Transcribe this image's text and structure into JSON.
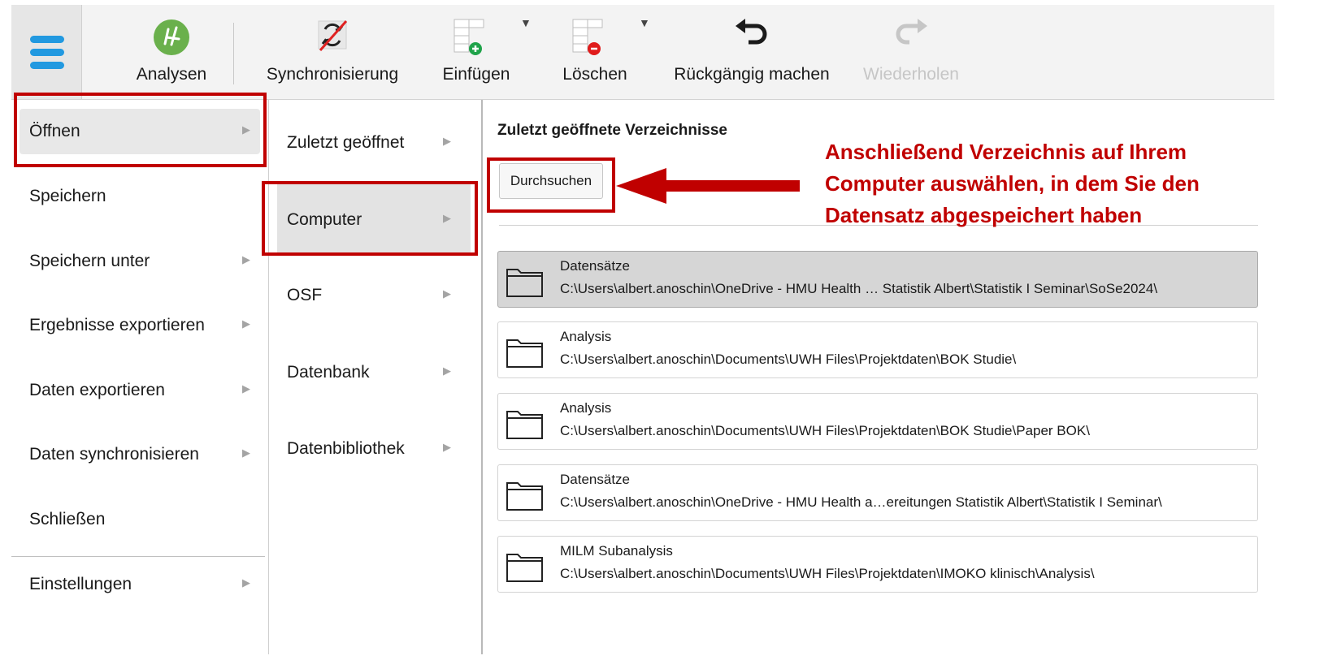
{
  "toolbar": {
    "analysen": "Analysen",
    "synchronisierung": "Synchronisierung",
    "einfuegen": "Einfügen",
    "loeschen": "Löschen",
    "rueckgaengig": "Rückgängig machen",
    "wiederholen": "Wiederholen"
  },
  "menu1": {
    "items": [
      {
        "label": "Öffnen"
      },
      {
        "label": "Speichern"
      },
      {
        "label": "Speichern unter"
      },
      {
        "label": "Ergebnisse exportieren"
      },
      {
        "label": "Daten exportieren"
      },
      {
        "label": "Daten synchronisieren"
      },
      {
        "label": "Schließen"
      },
      {
        "label": "Einstellungen"
      }
    ]
  },
  "menu2": {
    "items": [
      {
        "label": "Zuletzt geöffnet"
      },
      {
        "label": "Computer"
      },
      {
        "label": "OSF"
      },
      {
        "label": "Datenbank"
      },
      {
        "label": "Datenbibliothek"
      }
    ]
  },
  "panel": {
    "title": "Zuletzt geöffnete Verzeichnisse",
    "browse": "Durchsuchen",
    "entries": [
      {
        "name": "Datensätze",
        "path": "C:\\Users\\albert.anoschin\\OneDrive - HMU Health … Statistik Albert\\Statistik I Seminar\\SoSe2024\\"
      },
      {
        "name": "Analysis",
        "path": "C:\\Users\\albert.anoschin\\Documents\\UWH Files\\Projektdaten\\BOK Studie\\"
      },
      {
        "name": "Analysis",
        "path": "C:\\Users\\albert.anoschin\\Documents\\UWH Files\\Projektdaten\\BOK Studie\\Paper BOK\\"
      },
      {
        "name": "Datensätze",
        "path": "C:\\Users\\albert.anoschin\\OneDrive - HMU Health a…ereitungen Statistik Albert\\Statistik I Seminar\\"
      },
      {
        "name": "MILM Subanalysis",
        "path": "C:\\Users\\albert.anoschin\\Documents\\UWH Files\\Projektdaten\\IMOKO klinisch\\Analysis\\"
      }
    ]
  },
  "annotation": {
    "line1": "Anschließend Verzeichnis auf Ihrem",
    "line2": "Computer auswählen, in dem Sie den",
    "line3": "Datensatz abgespeichert haben"
  },
  "colors": {
    "accent": "#2299e0",
    "highlight": "#c00000",
    "analysen_icon": "#6ab04c"
  }
}
